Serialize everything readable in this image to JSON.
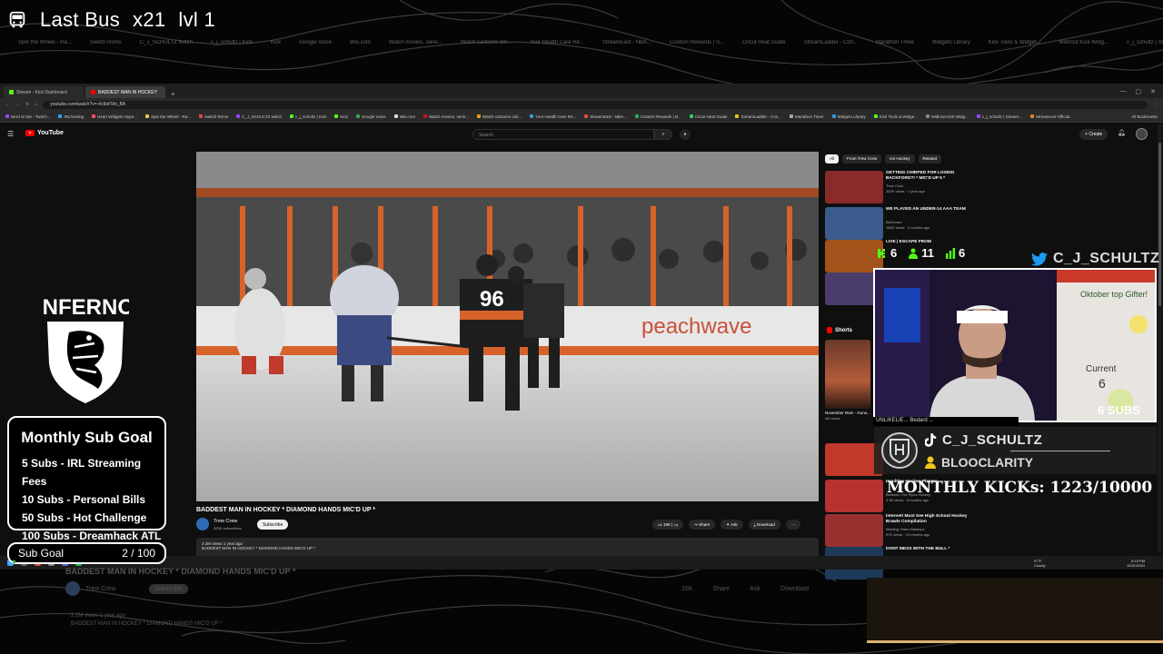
{
  "overlay": {
    "bus_label": "Last Bus",
    "multiplier": "x21",
    "level": "lvl 1"
  },
  "ghost_bookmarks": [
    "Spin the Wheel - Ra...",
    "Switch Roms",
    "C_J_SCHULTZ twitch",
    "c_j_schultz | Kick",
    "Kick",
    "Google Voice",
    "Wix.com",
    "Watch movies, serie...",
    "Watch cartoons onl...",
    "Your Health Care Re...",
    "StreamEast - NBA...",
    "Custom Rewards | S...",
    "Cricut Heat Guide",
    "StreamLadder - Con...",
    "Marathon Timer",
    "Widgets Library",
    "Kick Tools & Widget...",
    "Midlrost Kick Widg...",
    "c_j_schultz | Stream..."
  ],
  "browser": {
    "tabs": [
      {
        "label": "Stream - Kick Dashboard",
        "color": "#53fc18",
        "active": false
      },
      {
        "label": "BADDEST MAN IN HOCKEY",
        "color": "#ff0000",
        "active": true
      }
    ],
    "url": "youtube.com/watch?v=-4c9oF5hi_BA",
    "bookmarks": [
      {
        "label": "Nerd or Die - Twitch...",
        "color": "#9146ff"
      },
      {
        "label": "IRLhosting",
        "color": "#2aa3ff"
      },
      {
        "label": "Heart Widgets Hype...",
        "color": "#ff4a6a"
      },
      {
        "label": "Spin the Wheel - Ra...",
        "color": "#f2c94c"
      },
      {
        "label": "Switch Roms",
        "color": "#e44"
      },
      {
        "label": "C_J_SCHULTZ twitch",
        "color": "#9146ff"
      },
      {
        "label": "c_j_schultz | Kick",
        "color": "#53fc18"
      },
      {
        "label": "Kick",
        "color": "#53fc18"
      },
      {
        "label": "Google Voice",
        "color": "#34a853"
      },
      {
        "label": "Wix.com",
        "color": "#ddd"
      },
      {
        "label": "Watch movies, serie...",
        "color": "#e50914"
      },
      {
        "label": "Watch cartoons onli...",
        "color": "#f39c12"
      },
      {
        "label": "Your Health Care Re...",
        "color": "#2d9cdb"
      },
      {
        "label": "StreamEast - NBA...",
        "color": "#e74c3c"
      },
      {
        "label": "Custom Rewards | B...",
        "color": "#27ae60"
      },
      {
        "label": "Cricut Heat Guide",
        "color": "#2ecc71"
      },
      {
        "label": "StreamLadder - Con...",
        "color": "#f1c40f"
      },
      {
        "label": "Marathon Timer",
        "color": "#aaa"
      },
      {
        "label": "Widgets Library",
        "color": "#3498db"
      },
      {
        "label": "Kick Tools & Widge...",
        "color": "#53fc18"
      },
      {
        "label": "Midlrost Kick Widg...",
        "color": "#888"
      },
      {
        "label": "c_j_schultz | Stream...",
        "color": "#9146ff"
      },
      {
        "label": "Streamroot Official...",
        "color": "#e67e22"
      }
    ],
    "all_bookmarks": "All Bookmarks"
  },
  "youtube": {
    "logo": "YouTube",
    "search_placeholder": "Search",
    "create_label": "Create",
    "video_title": "BADDEST MAN IN HOCKEY * DIAMOND HANDS MIC'D UP *",
    "channel_name": "Trew Crew",
    "channel_subs": "300K subscribers",
    "subscribe_label": "Subscribe",
    "likes": "15K",
    "share_label": "Share",
    "ask_label": "Ask",
    "download_label": "Download",
    "description_line1": "2.2M views  1 year ago",
    "description_line2": "BADDEST MAN IN HOCKEY * DIAMOND HANDS MIC'D UP *",
    "chips": [
      {
        "label": "All",
        "active": true
      },
      {
        "label": "From Trew Crew",
        "active": false
      },
      {
        "label": "Ice Hockey",
        "active": false
      },
      {
        "label": "Related",
        "active": false
      }
    ],
    "recommendations": [
      {
        "title": "GETTING CHIRPED FOR LOSING BACKFORD?! * MIC'D UP 5 *",
        "channel": "Trew Crew",
        "views": "342K views · 1 year ago",
        "color": "#8a2b2b"
      },
      {
        "title": "WE PLAYED AN UNDER-14 AAA TEAM",
        "channel": "BizDream",
        "views": "285K views · 2 months ago",
        "color": "#3a5b8c"
      },
      {
        "title": "LIVE | ESCAPE FROM",
        "channel": "",
        "views": "",
        "color": "#a4521c"
      },
      {
        "title": "",
        "channel": "",
        "views": "",
        "color": "#4b3d6b"
      }
    ],
    "shorts_label": "Shorts",
    "short_title": "November Rain - Guns...",
    "short_views": "4M views",
    "lower_recommendations": [
      {
        "title": "",
        "channel": "",
        "views": "",
        "color": "#c0392b"
      },
      {
        "title": "Insulting Hockey Players",
        "channel": "Between The Pipes Hockey",
        "views": "3.3K views · 8 months ago",
        "color": "#b83232"
      },
      {
        "title": "Internet! Must See High School Hockey Brawls Compilation",
        "channel": "Melding Video Mashups",
        "views": "97K views · 10 months ago",
        "color": "#993030"
      },
      {
        "title": "DONT MESS WITH THE BULL *",
        "channel": "",
        "views": "",
        "color": "#1d3a5a"
      }
    ],
    "video_scene": {
      "jersey_number": "96",
      "sponsor": "peachwave"
    }
  },
  "taskbar": {
    "weather_temp": "57°F",
    "weather_desc": "Cloudy",
    "time": "8:19 PM",
    "date": "10/31/2024"
  },
  "ghost_under": {
    "title": "BADDEST MAN IN HOCKEY * DIAMOND HANDS MIC'D UP *",
    "channel": "Trew Crew",
    "subscribe": "Subscribe",
    "likes": "15K",
    "share": "Share",
    "ask": "Ask",
    "download": "Download",
    "views": "2.2M views  1 year ago",
    "desc": "BADDEST MAN IN HOCKEY * DIAMOND HANDS MIC'D UP *"
  },
  "left_overlay": {
    "logo_text": "INFERNO",
    "goal_title": "Monthly Sub Goal",
    "goals": [
      "5 Subs - IRL Streaming Fees",
      "10 Subs - Personal Bills",
      "50 Subs - Hot Challenge",
      "100 Subs - Dreamhack ATL"
    ],
    "subgoal_label": "Sub Goal",
    "subgoal_value": "2 / 100",
    "subgoal_progress": 0.02
  },
  "right_overlay": {
    "kick_stats": [
      {
        "icon": "kick-icon",
        "value": "6"
      },
      {
        "icon": "person-icon",
        "value": "11"
      },
      {
        "icon": "bars-icon",
        "value": "6"
      }
    ],
    "twitter_handle": "C_J_SCHULTZ",
    "cam_subs": "6 SUBS",
    "cam_ticker": "UNLIKELIE...                  Bedard ...",
    "tiktok_name": "C_J_SCHULTZ",
    "sub_name": "BLOOCLARITY",
    "monthly_kicks": "MONTHLY KICKs: 1223/10000",
    "whiteboard_text": "Oktober top Gifter!",
    "whiteboard_current": "Current",
    "whiteboard_number": "6"
  },
  "colors": {
    "kick_green": "#53fc18",
    "youtube_red": "#ff0000",
    "twitter_blue": "#1d9bf0",
    "sub_icon_yellow": "#f5c518"
  }
}
